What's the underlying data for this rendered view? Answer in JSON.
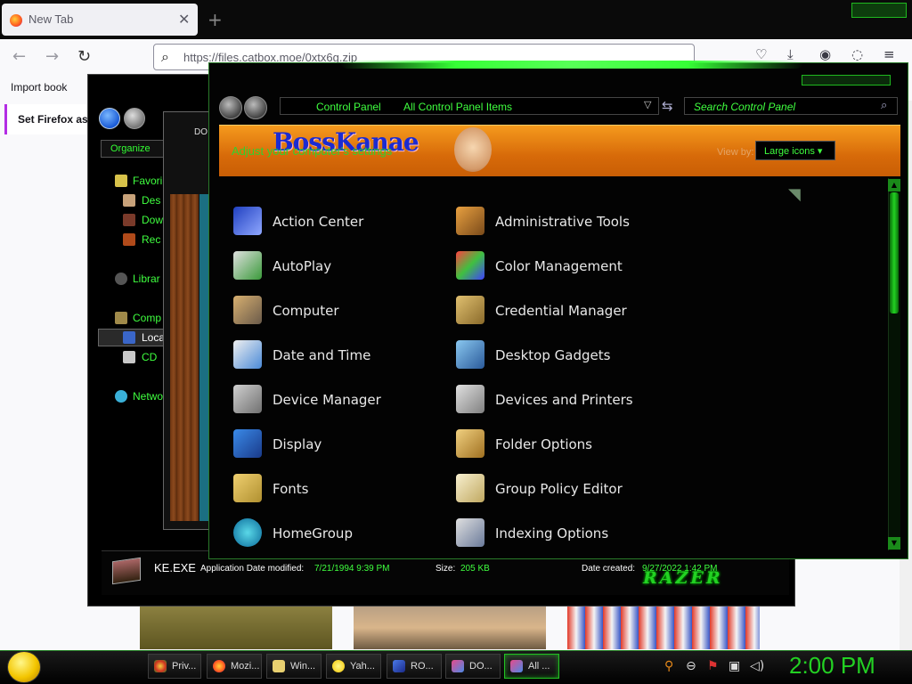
{
  "browser": {
    "tab_title": "New Tab",
    "tab_close": "✕",
    "new_tab": "+",
    "url": "https://files.catbox.moe/0xtx6g.zip",
    "bookmark_import": "Import book",
    "set_default": "Set Firefox as"
  },
  "explorer": {
    "organize": "Organize",
    "nav": {
      "favorites": "Favori",
      "desktop": "Des",
      "downloads": "Dow",
      "recent": "Rec",
      "libraries": "Librar",
      "computer": "Comp",
      "local": "Loca",
      "cd": "CD",
      "network": "Netwo"
    },
    "status": {
      "file": "KE.EXE",
      "type_label": "Application",
      "modified_label": "Date modified:",
      "modified_value": "7/21/1994 9:39 PM",
      "size_label": "Size:",
      "size_value": "205 KB",
      "created_label": "Date created:",
      "created_value": "9/27/2022 1:42 PM"
    },
    "brand": "RAZER"
  },
  "mid_window": {
    "label": "DO"
  },
  "control_panel": {
    "breadcrumbs": [
      "Control Panel",
      "All Control Panel Items"
    ],
    "search_placeholder": "Search Control Panel",
    "banner_logo": "BossKanae",
    "banner_subtitle": "Adjust your computer's settings",
    "view_by_label": "View by:",
    "view_by_value": "Large icons ▾",
    "items_left": [
      "Action Center",
      "AutoPlay",
      "Computer",
      "Date and Time",
      "Device Manager",
      "Display",
      "Fonts",
      "HomeGroup"
    ],
    "items_right": [
      "Administrative Tools",
      "Color Management",
      "Credential Manager",
      "Desktop Gadgets",
      "Devices and Printers",
      "Folder Options",
      "Group Policy Editor",
      "Indexing Options"
    ]
  },
  "taskbar": {
    "buttons": [
      "Priv...",
      "Mozi...",
      "Win...",
      "Yah...",
      "RO...",
      "DO...",
      "All ..."
    ],
    "clock": "2:00 PM"
  },
  "colors": {
    "accent_green": "#3fff3f",
    "banner_orange": "#e07b10"
  }
}
